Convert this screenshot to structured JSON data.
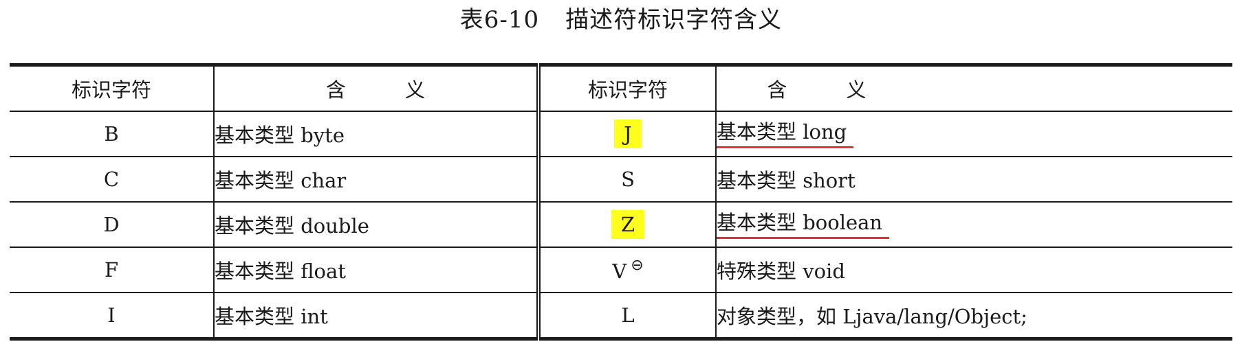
{
  "caption": {
    "number": "表6-10",
    "title": "描述符标识字符含义"
  },
  "headers": {
    "code": "标识字符",
    "meaning_left": "含",
    "meaning_right": "义"
  },
  "rows_left": [
    {
      "code": "B",
      "meaning": "基本类型 byte"
    },
    {
      "code": "C",
      "meaning": "基本类型 char"
    },
    {
      "code": "D",
      "meaning": "基本类型 double"
    },
    {
      "code": "F",
      "meaning": "基本类型 float"
    },
    {
      "code": "I",
      "meaning": "基本类型 int"
    }
  ],
  "rows_right": [
    {
      "code": "J",
      "meaning": "基本类型 long",
      "highlighted": true,
      "underlined": true
    },
    {
      "code": "S",
      "meaning": "基本类型 short"
    },
    {
      "code": "Z",
      "meaning": "基本类型 boolean",
      "highlighted": true,
      "underlined": true
    },
    {
      "code": "V",
      "meaning": "特殊类型 void",
      "footnote_mark": "⊖"
    },
    {
      "code": "L",
      "meaning": "对象类型，如 Ljava/lang/Object;"
    }
  ],
  "colors": {
    "highlight": "#ffff1e",
    "underline": "#e0303a",
    "rule": "#1a1a1a"
  }
}
